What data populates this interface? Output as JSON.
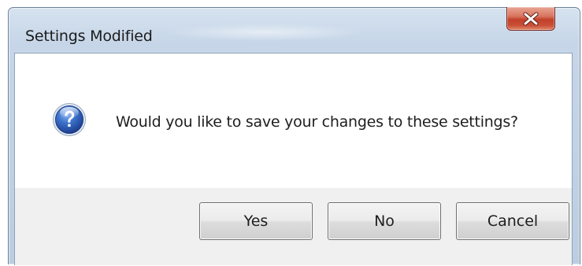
{
  "dialog": {
    "title": "Settings Modified",
    "message": "Would you like to save your changes to these settings?",
    "icon": "question-icon",
    "close_icon": "close-icon"
  },
  "buttons": {
    "yes": "Yes",
    "no": "No",
    "cancel": "Cancel"
  },
  "colors": {
    "close_button": "#c94f37",
    "question_icon": "#2b5fb8",
    "frame": "#c6d6e8"
  }
}
